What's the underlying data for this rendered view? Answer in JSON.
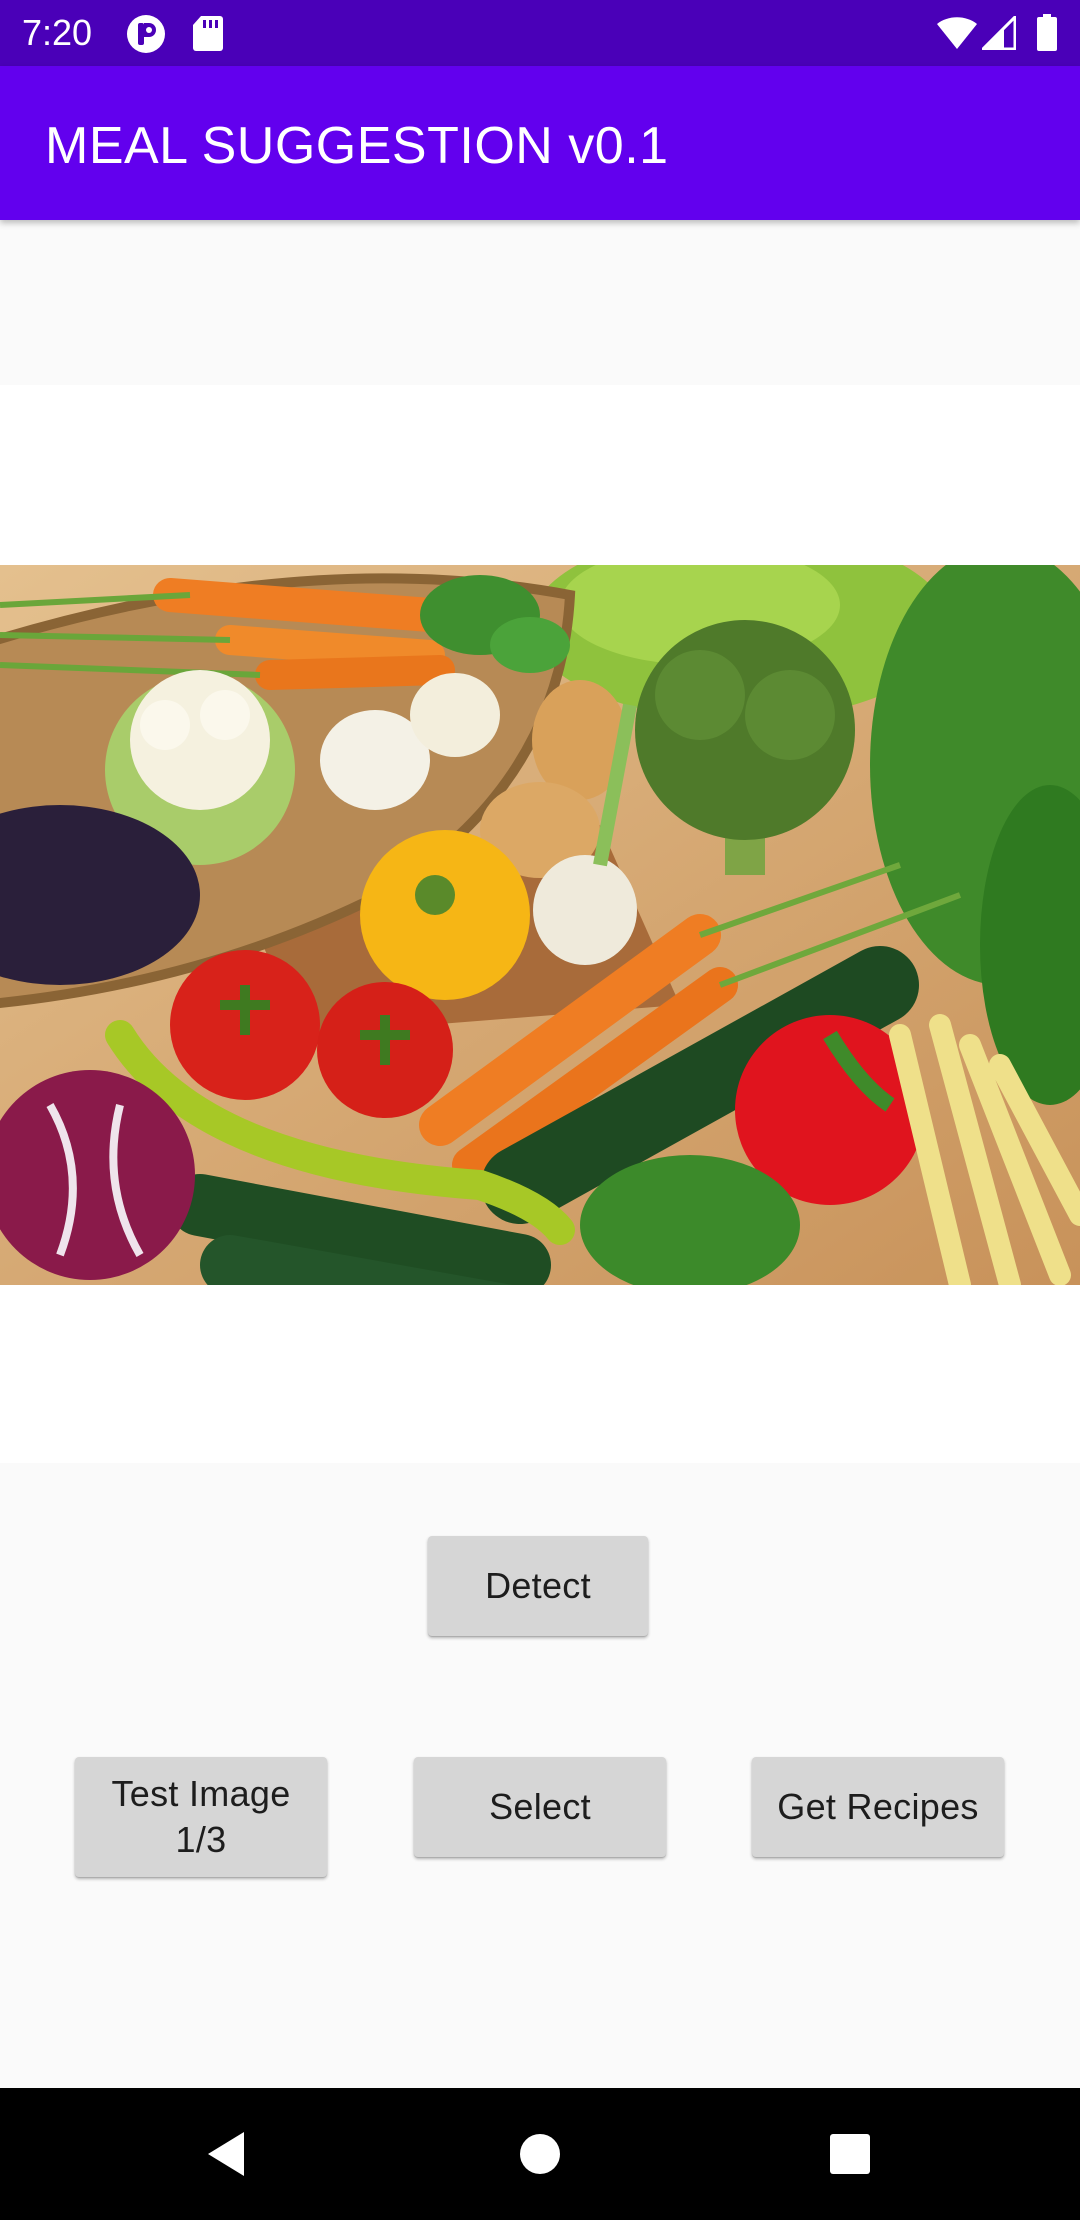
{
  "status_bar": {
    "time": "7:20",
    "left_icons": [
      "p-badge-icon",
      "sd-card-icon"
    ],
    "right_icons": [
      "wifi-icon",
      "cell-signal-icon",
      "battery-icon"
    ],
    "color": "#4a00b8"
  },
  "app_bar": {
    "title": "MEAL SUGGESTION v0.1",
    "color": "#6200ee"
  },
  "main": {
    "image": {
      "subject": "vegetables-photo"
    },
    "detect_button": "Detect",
    "test_image_button": "Test Image\n1/3",
    "select_button": "Select",
    "get_recipes_button": "Get Recipes"
  },
  "nav_bar": {
    "buttons": [
      "back-icon",
      "home-icon",
      "recents-icon"
    ]
  }
}
